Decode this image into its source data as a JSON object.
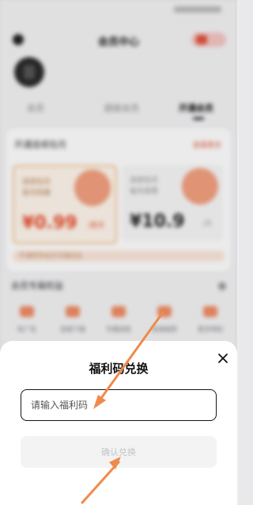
{
  "background": {
    "header": {
      "title": "会员中心"
    },
    "tabs": [
      {
        "label": "会员"
      },
      {
        "label": "超级会员"
      },
      {
        "label": "开通会员"
      }
    ],
    "card": {
      "title": "开通连续包月",
      "more": "查看更多",
      "plans": [
        {
          "sub1": "连续包月",
          "sub2": "首月特惠",
          "price": "¥0.99",
          "unit": "/首月"
        },
        {
          "sub1": "连续包月",
          "sub2": "每月续费",
          "price": "¥10.9",
          "unit": "/月"
        }
      ],
      "benefit_text": "开通即享会员专属权益"
    },
    "section2": {
      "title": "会员专属权益"
    },
    "features": [
      {
        "label": "免广告"
      },
      {
        "label": "加速下载"
      },
      {
        "label": "专属皮肤"
      },
      {
        "label": "高清画质"
      },
      {
        "label": "更多特权"
      }
    ]
  },
  "sheet": {
    "title": "福利码兑换",
    "input_placeholder": "请输入福利码",
    "confirm_label": "确认兑换",
    "colors": {
      "arrow": "#f08a4b",
      "button_bg": "#f3f3f4",
      "button_text": "#c4c4c8",
      "input_border": "#151515"
    }
  },
  "icons": {
    "close": "close-icon"
  }
}
